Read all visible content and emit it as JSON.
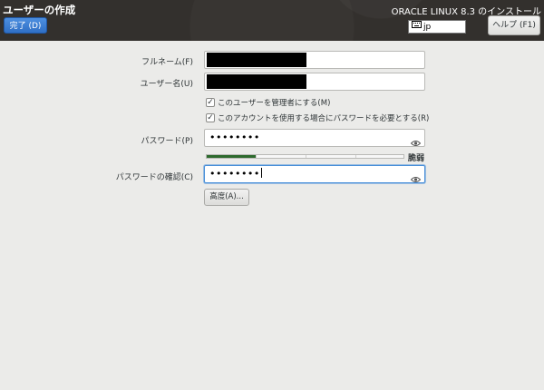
{
  "header": {
    "page_title": "ユーザーの作成",
    "done_button": "完了 (D)",
    "product_title": "ORACLE LINUX 8.3 のインストール",
    "keyboard_layout": "jp",
    "help_button": "ヘルプ (F1)"
  },
  "form": {
    "fullname_label": "フルネーム(F)",
    "username_label": "ユーザー名(U)",
    "admin_checkbox": {
      "label": "このユーザーを管理者にする(M)",
      "checked": true
    },
    "require_password_checkbox": {
      "label": "このアカウントを使用する場合にパスワードを必要とする(R)",
      "checked": true
    },
    "password_label": "パスワード(P)",
    "password_value": "••••••••",
    "strength": {
      "label": "脆弱",
      "level": 0.25
    },
    "confirm_label": "パスワードの確認(C)",
    "confirm_value": "••••••••",
    "advanced_button": "高度(A)..."
  },
  "colors": {
    "header_bg": "#33302d",
    "accent_blue": "#2f6fc5",
    "strength_fill": "#2d6a2d",
    "focus_border": "#4a90d9"
  }
}
